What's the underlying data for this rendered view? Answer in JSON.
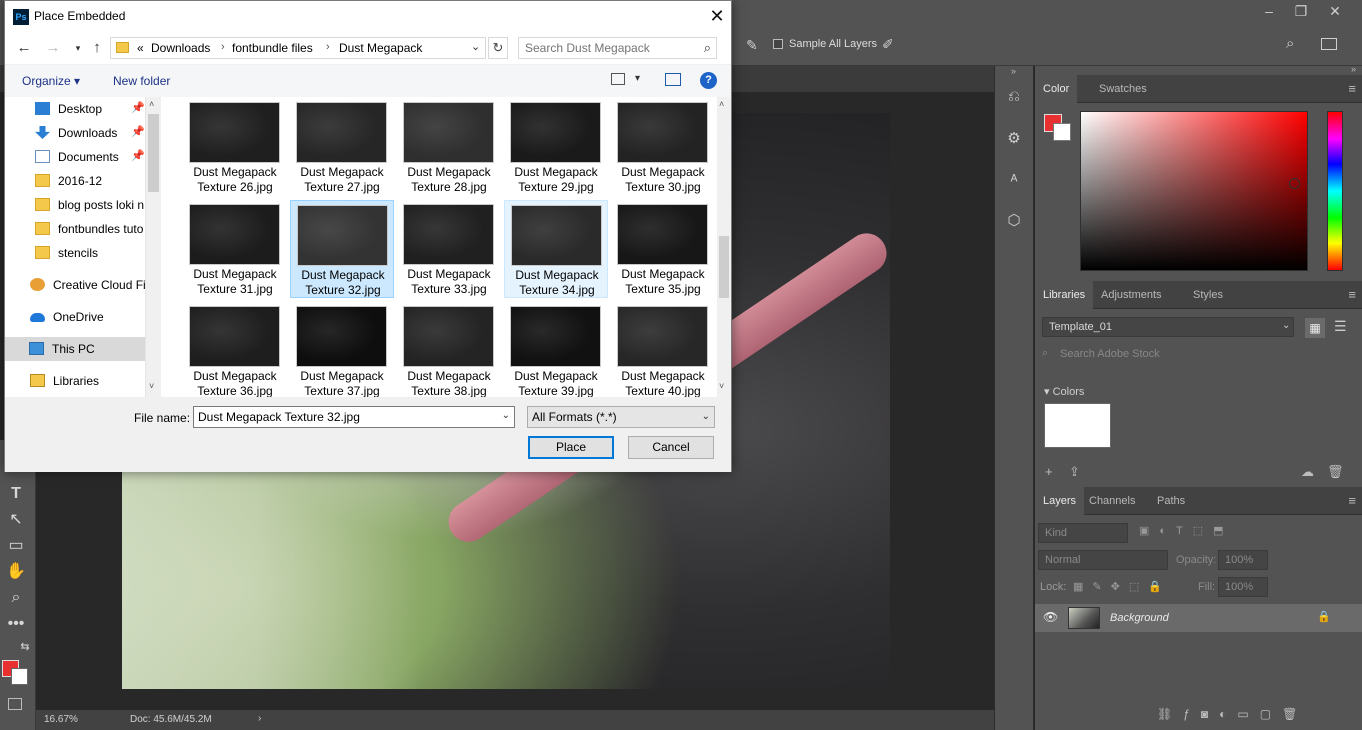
{
  "dialog": {
    "title": "Place Embedded",
    "close_glyph": "✕",
    "app_badge": "Ps",
    "address": {
      "overflow": "«",
      "crumbs": [
        "Downloads",
        "fontbundle files",
        "Dust Megapack"
      ],
      "chevron": "›"
    },
    "search_placeholder": "Search Dust Megapack",
    "toolbar": {
      "organize": "Organize ▾",
      "new_folder": "New folder",
      "help": "?"
    },
    "nav_items": [
      {
        "label": "Desktop",
        "icon": "desktop-icon",
        "pinned": true
      },
      {
        "label": "Downloads",
        "icon": "download-icon",
        "pinned": true
      },
      {
        "label": "Documents",
        "icon": "documents-icon",
        "pinned": true
      },
      {
        "label": "2016-12",
        "icon": "folder-icon",
        "pinned": false
      },
      {
        "label": "blog posts loki n",
        "icon": "folder-icon",
        "pinned": false
      },
      {
        "label": "fontbundles tuto",
        "icon": "folder-icon",
        "pinned": false
      },
      {
        "label": "stencils",
        "icon": "folder-icon",
        "pinned": false
      },
      {
        "label": "Creative Cloud Fil",
        "icon": "creative-cloud-icon",
        "pinned": false
      },
      {
        "label": "OneDrive",
        "icon": "onedrive-icon",
        "pinned": false
      },
      {
        "label": "This PC",
        "icon": "this-pc-icon",
        "pinned": false
      },
      {
        "label": "Libraries",
        "icon": "libraries-icon",
        "pinned": false
      }
    ],
    "files": [
      {
        "line1": "Dust Megapack",
        "line2": "Texture 26.jpg"
      },
      {
        "line1": "Dust Megapack",
        "line2": "Texture 27.jpg"
      },
      {
        "line1": "Dust Megapack",
        "line2": "Texture 28.jpg"
      },
      {
        "line1": "Dust Megapack",
        "line2": "Texture 29.jpg"
      },
      {
        "line1": "Dust Megapack",
        "line2": "Texture 30.jpg"
      },
      {
        "line1": "Dust Megapack",
        "line2": "Texture 31.jpg"
      },
      {
        "line1": "Dust Megapack",
        "line2": "Texture 32.jpg",
        "state": "selected"
      },
      {
        "line1": "Dust Megapack",
        "line2": "Texture 33.jpg"
      },
      {
        "line1": "Dust Megapack",
        "line2": "Texture 34.jpg",
        "state": "hover"
      },
      {
        "line1": "Dust Megapack",
        "line2": "Texture 35.jpg"
      },
      {
        "line1": "Dust Megapack",
        "line2": "Texture 36.jpg"
      },
      {
        "line1": "Dust Megapack",
        "line2": "Texture 37.jpg"
      },
      {
        "line1": "Dust Megapack",
        "line2": "Texture 38.jpg"
      },
      {
        "line1": "Dust Megapack",
        "line2": "Texture 39.jpg"
      },
      {
        "line1": "Dust Megapack",
        "line2": "Texture 40.jpg"
      }
    ],
    "file_name_label": "File name:",
    "file_name_value": "Dust Megapack Texture 32.jpg",
    "format": "All Formats (*.*)",
    "place_button": "Place",
    "cancel_button": "Cancel"
  },
  "photoshop": {
    "options_bar": {
      "sample_all_layers": "Sample All Layers"
    },
    "status": {
      "zoom": "16.67%",
      "doc": "Doc: 45.6M/45.2M"
    },
    "color_panel": {
      "tabs": [
        "Color",
        "Swatches"
      ],
      "foreground": "#e83030",
      "background": "#ffffff"
    },
    "libraries_panel": {
      "tabs": [
        "Libraries",
        "Adjustments",
        "Styles"
      ],
      "library": "Template_01",
      "search_placeholder": "Search Adobe Stock",
      "section": "Colors"
    },
    "layers_panel": {
      "tabs": [
        "Layers",
        "Channels",
        "Paths"
      ],
      "kind": "Kind",
      "blend_mode": "Normal",
      "opacity_label": "Opacity:",
      "opacity_value": "100%",
      "lock_label": "Lock:",
      "fill_label": "Fill:",
      "fill_value": "100%",
      "layers": [
        {
          "name": "Background",
          "visible": true,
          "locked": true
        }
      ]
    }
  },
  "colors": {
    "accent": "#0078d7",
    "link": "#1e3287",
    "ps_bg": "#535353"
  }
}
